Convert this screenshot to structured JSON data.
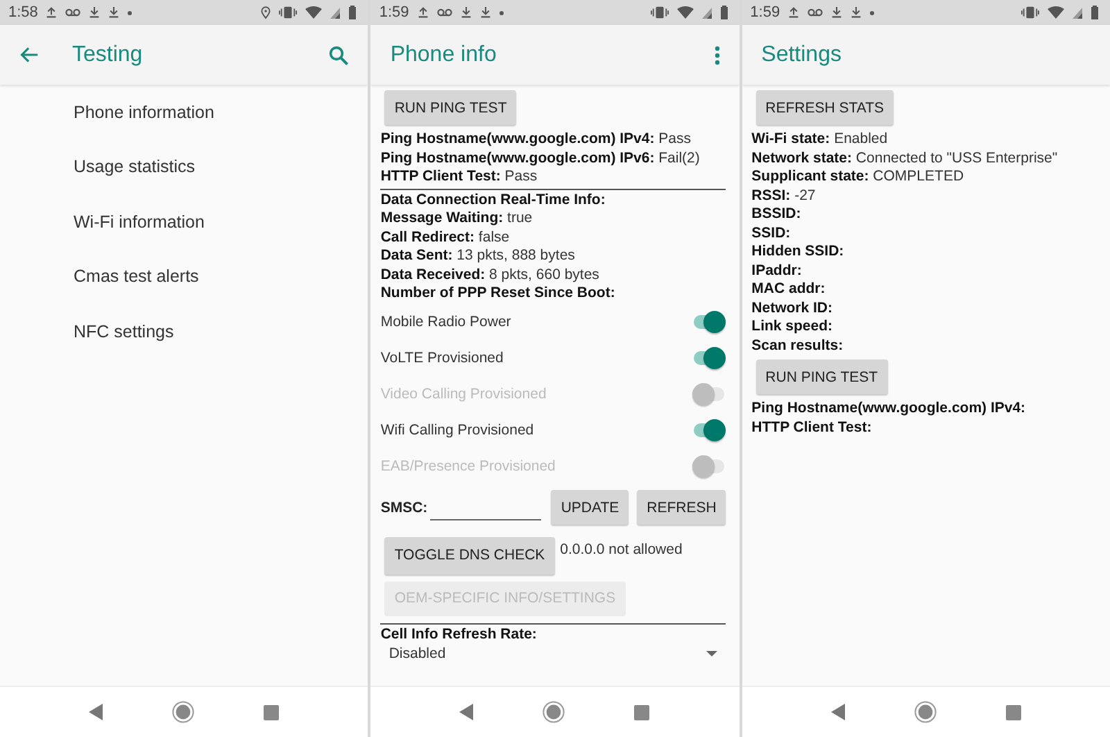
{
  "screens": [
    {
      "kind": "list",
      "status_bar": {
        "time": "1:58",
        "location": true
      },
      "app_bar": {
        "title": "Testing",
        "back": true,
        "search": true,
        "menu": false
      },
      "content": [
        {
          "kind": "list_item",
          "label": "Phone information"
        },
        {
          "kind": "list_item",
          "label": "Usage statistics"
        },
        {
          "kind": "list_item",
          "label": "Wi-Fi information"
        },
        {
          "kind": "list_item",
          "label": "Cmas test alerts"
        },
        {
          "kind": "list_item",
          "label": "NFC settings"
        }
      ]
    },
    {
      "kind": "form",
      "status_bar": {
        "time": "1:59",
        "location": false
      },
      "app_bar": {
        "title": "Phone info",
        "back": false,
        "search": false,
        "menu": true
      },
      "content": [
        {
          "kind": "button",
          "label": "RUN PING TEST",
          "disabled": false
        },
        {
          "kind": "info",
          "label": "Ping Hostname(www.google.com) IPv4:",
          "value": "Pass"
        },
        {
          "kind": "info",
          "label": "Ping Hostname(www.google.com) IPv6:",
          "value": "Fail(2)"
        },
        {
          "kind": "info",
          "label": "HTTP Client Test:",
          "value": "Pass"
        },
        {
          "kind": "divider"
        },
        {
          "kind": "info",
          "label": "Data Connection Real-Time Info:"
        },
        {
          "kind": "info",
          "label": "Message Waiting:",
          "value": "true"
        },
        {
          "kind": "info",
          "label": "Call Redirect:",
          "value": "false"
        },
        {
          "kind": "info",
          "label": "Data Sent:",
          "value": "13 pkts, 888 bytes"
        },
        {
          "kind": "info",
          "label": "Data Received:",
          "value": "8 pkts, 660 bytes"
        },
        {
          "kind": "info",
          "label": "Number of PPP Reset Since Boot:"
        },
        {
          "kind": "toggle",
          "label": "Mobile Radio Power",
          "on": true,
          "disabled": false
        },
        {
          "kind": "toggle",
          "label": "VoLTE Provisioned",
          "on": true,
          "disabled": false
        },
        {
          "kind": "toggle",
          "label": "Video Calling Provisioned",
          "on": false,
          "disabled": true
        },
        {
          "kind": "toggle",
          "label": "Wifi Calling Provisioned",
          "on": true,
          "disabled": false
        },
        {
          "kind": "toggle",
          "label": "EAB/Presence Provisioned",
          "on": false,
          "disabled": true
        },
        {
          "kind": "smsc",
          "label": "SMSC:",
          "buttons": [
            "UPDATE",
            "REFRESH"
          ]
        },
        {
          "kind": "dns",
          "button": "TOGGLE DNS CHECK",
          "note": "0.0.0.0 not allowed"
        },
        {
          "kind": "button",
          "label": "OEM-SPECIFIC INFO/SETTINGS",
          "disabled": true
        },
        {
          "kind": "divider"
        },
        {
          "kind": "info",
          "label": "Cell Info Refresh Rate:"
        },
        {
          "kind": "spinner",
          "value": "Disabled"
        }
      ]
    },
    {
      "kind": "form",
      "status_bar": {
        "time": "1:59",
        "location": false
      },
      "app_bar": {
        "title": "Settings",
        "back": false,
        "search": false,
        "menu": false
      },
      "content": [
        {
          "kind": "button",
          "label": "REFRESH STATS",
          "disabled": false
        },
        {
          "kind": "info",
          "label": "Wi-Fi state:",
          "value": "Enabled"
        },
        {
          "kind": "info",
          "label": "Network state:",
          "value": "Connected to \"USS Enterprise\""
        },
        {
          "kind": "info",
          "label": "Supplicant state:",
          "value": "COMPLETED"
        },
        {
          "kind": "info",
          "label": "RSSI:",
          "value": "-27"
        },
        {
          "kind": "info",
          "label": "BSSID:"
        },
        {
          "kind": "info",
          "label": "SSID:"
        },
        {
          "kind": "info",
          "label": "Hidden SSID:"
        },
        {
          "kind": "info",
          "label": "IPaddr:"
        },
        {
          "kind": "info",
          "label": "MAC addr:"
        },
        {
          "kind": "info",
          "label": "Network ID:"
        },
        {
          "kind": "info",
          "label": "Link speed:"
        },
        {
          "kind": "info",
          "label": "Scan results:"
        },
        {
          "kind": "button",
          "label": "RUN PING TEST",
          "disabled": false
        },
        {
          "kind": "info",
          "label": "Ping Hostname(www.google.com) IPv4:"
        },
        {
          "kind": "info",
          "label": "HTTP Client Test:"
        }
      ]
    }
  ]
}
